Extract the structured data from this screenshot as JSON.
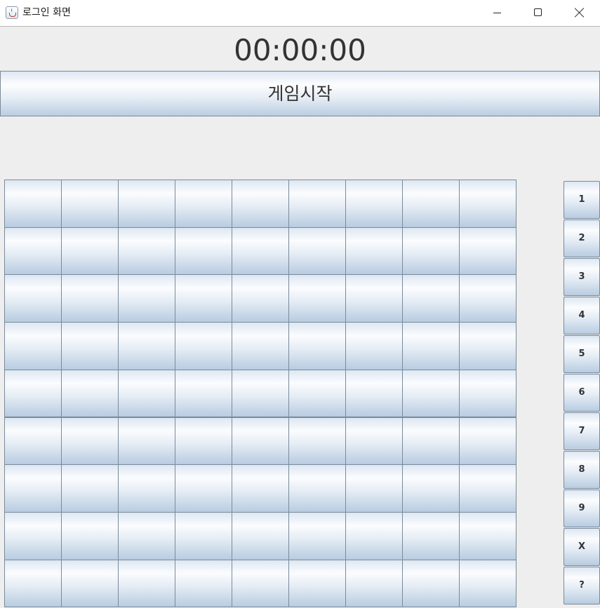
{
  "window": {
    "title": "로그인 화면",
    "icon": "java-cup-icon"
  },
  "timer": {
    "text": "00:00:00"
  },
  "start_button": {
    "label": "게임시작"
  },
  "grid": {
    "rows": 9,
    "cols": 9,
    "cells": []
  },
  "number_pad": {
    "buttons": [
      "1",
      "2",
      "3",
      "4",
      "5",
      "6",
      "7",
      "8",
      "9",
      "X",
      "?"
    ]
  },
  "colors": {
    "background": "#eeeeee",
    "button_border": "#7a8a99",
    "text": "#333333"
  }
}
